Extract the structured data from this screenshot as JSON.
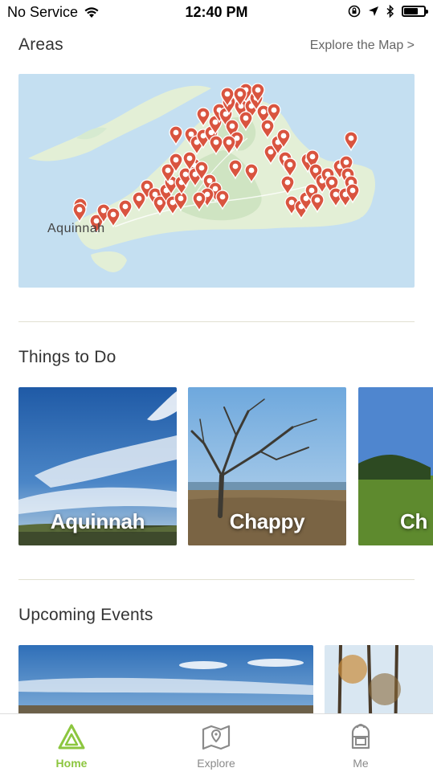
{
  "status_bar": {
    "carrier": "No Service",
    "time": "12:40 PM",
    "battery_level": 0.7
  },
  "areas": {
    "title": "Areas",
    "explore_link": "Explore the Map >",
    "map_label": "Aquinnah"
  },
  "things_to_do": {
    "title": "Things to Do",
    "cards": [
      {
        "label": "Aquinnah"
      },
      {
        "label": "Chappy"
      },
      {
        "label": "Ch"
      }
    ]
  },
  "upcoming_events": {
    "title": "Upcoming Events"
  },
  "tab_bar": {
    "tabs": [
      {
        "label": "Home",
        "icon": "home-triangle-icon",
        "active": true
      },
      {
        "label": "Explore",
        "icon": "map-pin-icon",
        "active": false
      },
      {
        "label": "Me",
        "icon": "backpack-icon",
        "active": false
      }
    ]
  },
  "colors": {
    "accent": "#8cc63f",
    "pin": "#d9543f",
    "water": "#c4dff1",
    "land": "#e3efd6"
  }
}
